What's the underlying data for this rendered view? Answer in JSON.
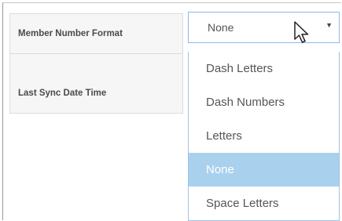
{
  "form": {
    "member_number_format_label": "Member Number Format",
    "last_sync_label": "Last Sync Date Time"
  },
  "select": {
    "value": "None",
    "caret_icon": "caret-down-icon"
  },
  "dropdown": {
    "options": [
      "Dash Letters",
      "Dash Numbers",
      "Letters",
      "None",
      "Space Letters"
    ],
    "highlighted_index": 3
  },
  "colors": {
    "highlight": "#a9d1ed",
    "select_border": "#8db8e8"
  },
  "cursor": {
    "icon": "mouse-pointer-icon"
  }
}
